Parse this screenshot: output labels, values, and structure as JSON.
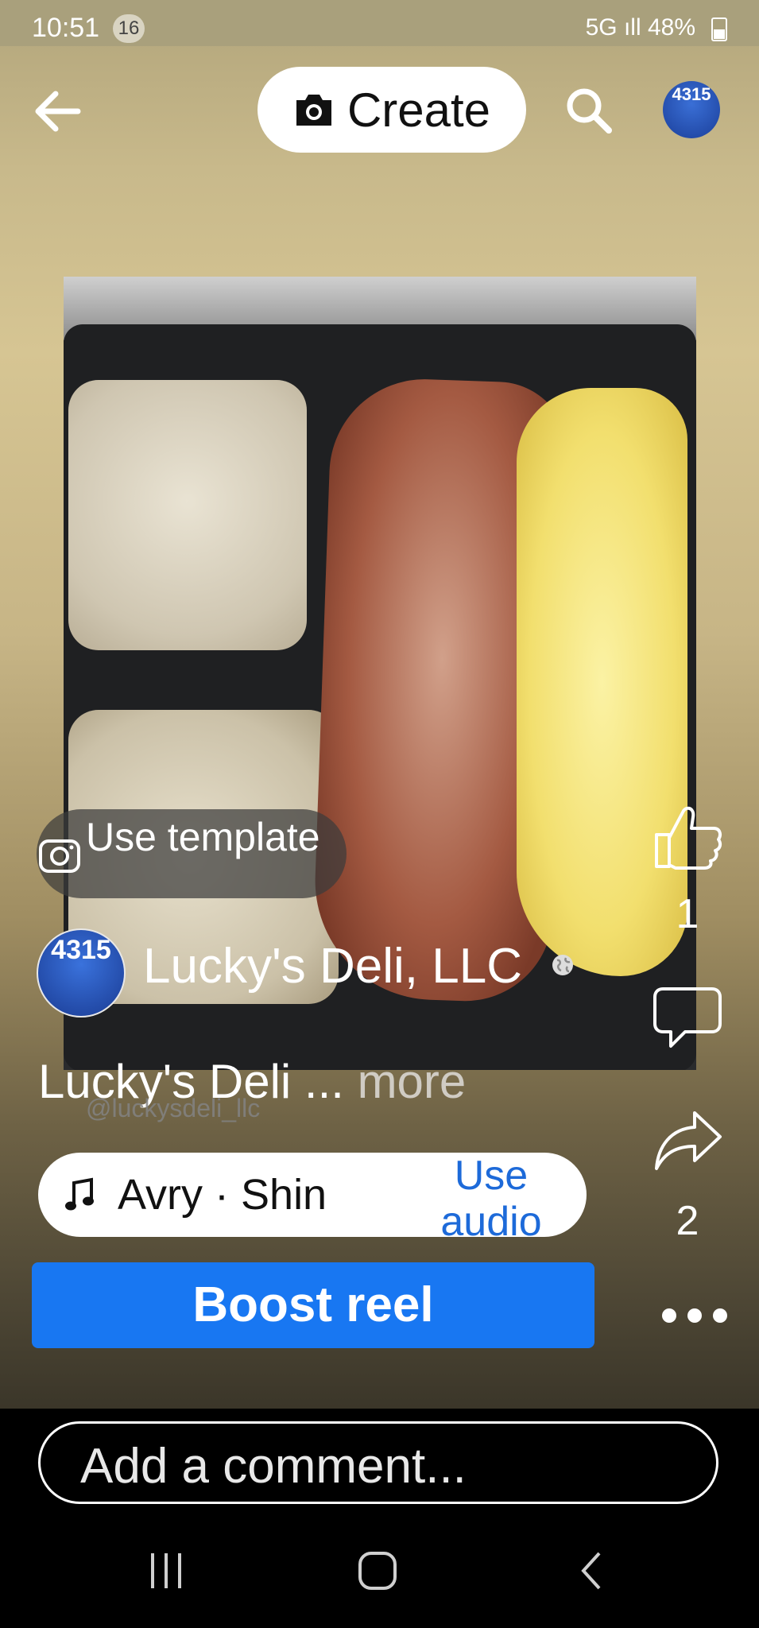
{
  "status_bar": {
    "time": "10:51",
    "notification_count": "16",
    "network": "5G",
    "battery": "48%"
  },
  "top_bar": {
    "create_label": "Create",
    "avatar_text": "4315"
  },
  "template": {
    "label": "Use template"
  },
  "post": {
    "page_name": "Lucky's Deli, LLC",
    "avatar_text": "4315",
    "caption": "Lucky's Deli ...",
    "more_label": "more",
    "handle": "@luckysdeli_llc"
  },
  "actions": {
    "like_count": "1",
    "share_count": "2"
  },
  "audio": {
    "song": "Avry · Shin",
    "use_audio_label": "Use audio"
  },
  "boost": {
    "label": "Boost reel"
  },
  "comment": {
    "placeholder": "Add a comment..."
  },
  "colors": {
    "accent": "#1877f2",
    "link": "#1d6ad9"
  }
}
